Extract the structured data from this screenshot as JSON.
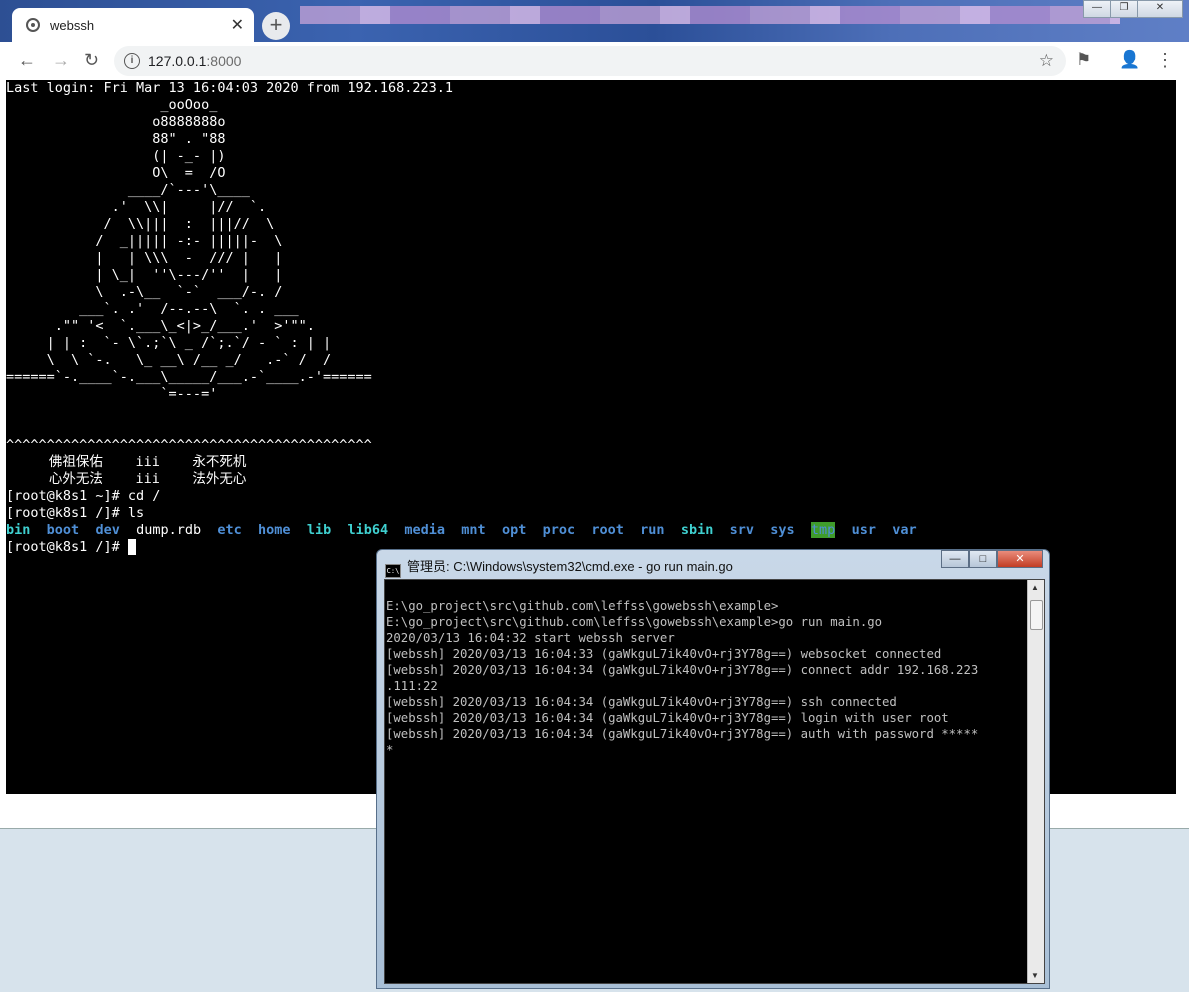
{
  "browser": {
    "tab_title": "webssh",
    "tab_close": "✕",
    "new_tab": "+",
    "window_controls": {
      "minimize": "—",
      "maximize": "❐",
      "close": "✕"
    },
    "nav": {
      "back": "←",
      "forward": "→",
      "reload": "↻"
    },
    "url_host": "127.0.0.1",
    "url_port": ":8000",
    "info_icon": "i",
    "bookmark_star": "☆",
    "flag": "⚑",
    "profile": "👤",
    "menu": "⋮"
  },
  "terminal": {
    "lines": [
      "Last login: Fri Mar 13 16:04:03 2020 from 192.168.223.1",
      "                   _ooOoo_",
      "                  o8888888o",
      "                  88\" . \"88",
      "                  (| -_- |)",
      "                  O\\  =  /O",
      "               ____/`---'\\____",
      "             .'  \\\\|     |//  `.",
      "            /  \\\\|||  :  |||//  \\",
      "           /  _||||| -:- |||||-  \\",
      "           |   | \\\\\\  -  /// |   |",
      "           | \\_|  ''\\---/''  |   |",
      "           \\  .-\\__  `-`  ___/-. /",
      "         ___`. .'  /--.--\\  `. . ___",
      "      .\"\" '<  `.___\\_<|>_/___.'  >'\"\".",
      "     | | :  `- \\`.;`\\ _ /`;.`/ - ` : | |",
      "     \\  \\ `-.   \\_ __\\ /__ _/   .-` /  /",
      "======`-.____`-.___\\_____/___.-`____.-'======",
      "                   `=---='",
      "",
      "",
      "^^^^^^^^^^^^^^^^^^^^^^^^^^^^^^^^^^^^^^^^^^^^^"
    ],
    "blessing_1a": "佛祖保佑",
    "blessing_1b": "iii",
    "blessing_1c": "永不死机",
    "blessing_2a": "心外无法",
    "blessing_2b": "iii",
    "blessing_2c": "法外无心",
    "cmd1": "[root@k8s1 ~]# cd /",
    "cmd2": "[root@k8s1 /]# ls",
    "ls_entries": [
      {
        "name": "bin",
        "kind": "dir-cyan"
      },
      {
        "name": "boot",
        "kind": "dir"
      },
      {
        "name": "dev",
        "kind": "dir"
      },
      {
        "name": "dump.rdb",
        "kind": "file"
      },
      {
        "name": "etc",
        "kind": "dir"
      },
      {
        "name": "home",
        "kind": "dir"
      },
      {
        "name": "lib",
        "kind": "dir-cyan"
      },
      {
        "name": "lib64",
        "kind": "dir-cyan"
      },
      {
        "name": "media",
        "kind": "dir"
      },
      {
        "name": "mnt",
        "kind": "dir"
      },
      {
        "name": "opt",
        "kind": "dir"
      },
      {
        "name": "proc",
        "kind": "dir"
      },
      {
        "name": "root",
        "kind": "dir"
      },
      {
        "name": "run",
        "kind": "dir"
      },
      {
        "name": "sbin",
        "kind": "dir-cyan"
      },
      {
        "name": "srv",
        "kind": "dir"
      },
      {
        "name": "sys",
        "kind": "dir"
      },
      {
        "name": "tmp",
        "kind": "tmpdir"
      },
      {
        "name": "usr",
        "kind": "dir"
      },
      {
        "name": "var",
        "kind": "dir"
      }
    ],
    "prompt": "[root@k8s1 /]# "
  },
  "cmd_window": {
    "title": "管理员: C:\\Windows\\system32\\cmd.exe - go  run main.go",
    "icon_text": "C:\\",
    "buttons": {
      "minimize": "—",
      "maximize": "□",
      "close": "✕"
    },
    "lines": [
      "E:\\go_project\\src\\github.com\\leffss\\gowebssh\\example>",
      "E:\\go_project\\src\\github.com\\leffss\\gowebssh\\example>go run main.go",
      "2020/03/13 16:04:32 start webssh server",
      "[webssh] 2020/03/13 16:04:33 (gaWkguL7ik40vO+rj3Y78g==) websocket connected",
      "[webssh] 2020/03/13 16:04:34 (gaWkguL7ik40vO+rj3Y78g==) connect addr 192.168.223",
      ".111:22",
      "[webssh] 2020/03/13 16:04:34 (gaWkguL7ik40vO+rj3Y78g==) ssh connected",
      "[webssh] 2020/03/13 16:04:34 (gaWkguL7ik40vO+rj3Y78g==) login with user root",
      "[webssh] 2020/03/13 16:04:34 (gaWkguL7ik40vO+rj3Y78g==) auth with password *****",
      "*"
    ],
    "scroll_up": "▲",
    "scroll_down": "▼"
  }
}
